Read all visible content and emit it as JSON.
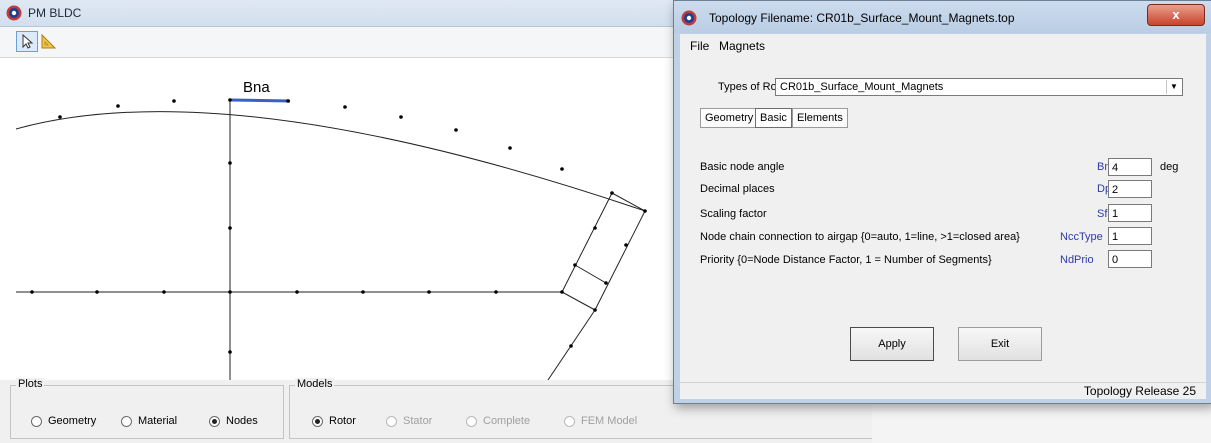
{
  "main": {
    "title": "PM BLDC",
    "canvas_label": "Bna",
    "plots": {
      "label": "Plots",
      "options": [
        {
          "label": "Geometry",
          "selected": false
        },
        {
          "label": "Material",
          "selected": false
        },
        {
          "label": "Nodes",
          "selected": true
        }
      ]
    },
    "models": {
      "label": "Models",
      "options": [
        {
          "label": "Rotor",
          "selected": true,
          "enabled": true
        },
        {
          "label": "Stator",
          "selected": false,
          "enabled": false
        },
        {
          "label": "Complete",
          "selected": false,
          "enabled": false
        },
        {
          "label": "FEM Model",
          "selected": false,
          "enabled": false
        }
      ]
    }
  },
  "dialog": {
    "title": "Topology Filename: CR01b_Surface_Mount_Magnets.top",
    "close": "x",
    "menu": [
      "File",
      "Magnets"
    ],
    "rotor_type_label": "Types of Rotor:",
    "rotor_type_value": "CR01b_Surface_Mount_Magnets",
    "tabs": [
      "Geometry",
      "Basic",
      "Elements"
    ],
    "params": [
      {
        "label": "Basic node angle",
        "abbr": "Bna",
        "value": "4",
        "unit": "deg"
      },
      {
        "label": "Decimal places",
        "abbr": "Dp",
        "value": "2",
        "unit": ""
      },
      {
        "label": "Scaling factor",
        "abbr": "Sf",
        "value": "1",
        "unit": ""
      },
      {
        "label": "Node chain connection to airgap {0=auto, 1=line, >1=closed area}",
        "abbr": "NccType",
        "value": "1",
        "unit": ""
      },
      {
        "label": "Priority {0=Node Distance Factor, 1 = Number of Segments}",
        "abbr": "NdPrio",
        "value": "0",
        "unit": ""
      }
    ],
    "apply": "Apply",
    "exit": "Exit",
    "status": "Topology Release 25"
  },
  "colors": {
    "highlight": "#3a5fcd",
    "abbr": "#2e3aa8"
  }
}
